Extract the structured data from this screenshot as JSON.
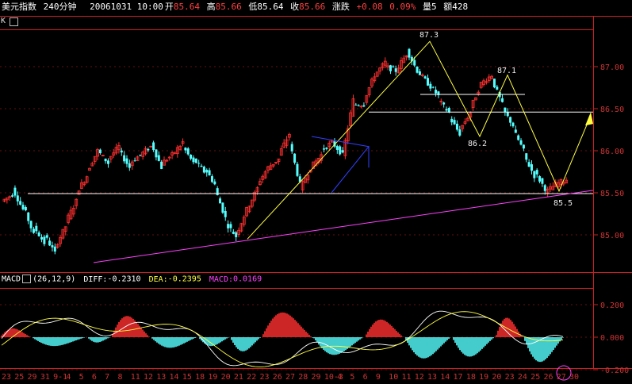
{
  "header": {
    "title": "美元指数",
    "period": "240分钟",
    "date_time": "20061031 10:00",
    "open_label": "开",
    "open": "85.64",
    "high_label": "高",
    "high": "85.66",
    "low_label": "低",
    "low": "85.64",
    "close_label": "收",
    "close": "85.66",
    "change_label": "涨跌",
    "change": "+0.08",
    "change_pct": "0.09%",
    "volume_label": "量5",
    "amount_label": "额428"
  },
  "tab_label": "K",
  "colors": {
    "up": "#ff3030",
    "down": "#55ffff",
    "axis": "#cc2020",
    "white_line": "#ffffff",
    "yellow": "#ffff40",
    "magenta": "#ff40ff",
    "blue": "#3040ff"
  },
  "macd": {
    "name": "MACD",
    "params": "(26,12,9)",
    "diff_label": "DIFF:",
    "diff": "-0.2310",
    "dea_label": "DEA:",
    "dea": "-0.2395",
    "macd_label": "MACD:",
    "macd_val": "0.0169"
  },
  "annotations": {
    "peak1": "87.3",
    "peak2": "87.1",
    "trough1": "86.2",
    "trough2": "85.5"
  },
  "chart_data": {
    "type": "candlestick",
    "price_axis": {
      "ticks": [
        "87.00",
        "86.50",
        "86.00",
        "85.50",
        "85.00"
      ],
      "values": [
        87.0,
        86.5,
        86.0,
        85.5,
        85.0
      ]
    },
    "macd_axis": {
      "ticks": [
        "0.200",
        "0.000",
        "-0.200"
      ],
      "values": [
        0.2,
        0.0,
        -0.2
      ]
    },
    "date_labels": [
      "23",
      "25",
      "29",
      "31",
      "9-1",
      "4",
      "5",
      "6",
      "7",
      "8",
      "11",
      "12",
      "13",
      "14",
      "15",
      "18",
      "19",
      "20",
      "21",
      "22",
      "23",
      "26",
      "27",
      "28",
      "29",
      "10-3",
      "4",
      "5",
      "6",
      "9",
      "10",
      "11",
      "12",
      "13",
      "14",
      "17",
      "18",
      "19",
      "20",
      "23",
      "24",
      "25",
      "26",
      "27",
      "30"
    ],
    "highlight_dates": [
      "9-1",
      "10-3"
    ],
    "close_path": [
      [
        85.4,
        85.48
      ],
      [
        85.55,
        85.3
      ],
      [
        85.35,
        85.0
      ],
      [
        85.1,
        84.9
      ],
      [
        85.0,
        84.78
      ],
      [
        84.85,
        85.1
      ],
      [
        85.15,
        85.4
      ],
      [
        85.5,
        85.7
      ],
      [
        85.75,
        86.0
      ],
      [
        86.0,
        85.85
      ],
      [
        85.9,
        86.05
      ],
      [
        86.0,
        85.8
      ],
      [
        85.85,
        85.95
      ],
      [
        85.95,
        86.05
      ],
      [
        86.1,
        85.8
      ],
      [
        85.85,
        85.95
      ],
      [
        85.95,
        86.1
      ],
      [
        86.05,
        85.85
      ],
      [
        85.9,
        85.75
      ],
      [
        85.8,
        85.6
      ],
      [
        85.55,
        85.2
      ],
      [
        85.15,
        84.98
      ],
      [
        85.0,
        85.3
      ],
      [
        85.3,
        85.55
      ],
      [
        85.6,
        85.8
      ],
      [
        85.8,
        85.9
      ],
      [
        85.95,
        86.2
      ],
      [
        86.1,
        85.6
      ],
      [
        85.55,
        85.8
      ],
      [
        85.8,
        85.95
      ],
      [
        86.0,
        86.1
      ],
      [
        86.1,
        85.95
      ],
      [
        85.95,
        86.6
      ],
      [
        86.55,
        86.55
      ],
      [
        86.6,
        86.9
      ],
      [
        86.9,
        87.05
      ],
      [
        87.0,
        86.95
      ],
      [
        86.95,
        87.15
      ],
      [
        87.2,
        86.95
      ],
      [
        86.95,
        86.8
      ],
      [
        86.8,
        86.65
      ],
      [
        86.6,
        86.45
      ],
      [
        86.4,
        86.2
      ],
      [
        86.25,
        86.45
      ],
      [
        86.5,
        86.8
      ],
      [
        86.8,
        86.9
      ],
      [
        86.85,
        86.55
      ],
      [
        86.5,
        86.3
      ],
      [
        86.25,
        86.0
      ],
      [
        85.95,
        85.7
      ],
      [
        85.75,
        85.55
      ],
      [
        85.5,
        85.6
      ],
      [
        85.6,
        85.66
      ]
    ]
  }
}
